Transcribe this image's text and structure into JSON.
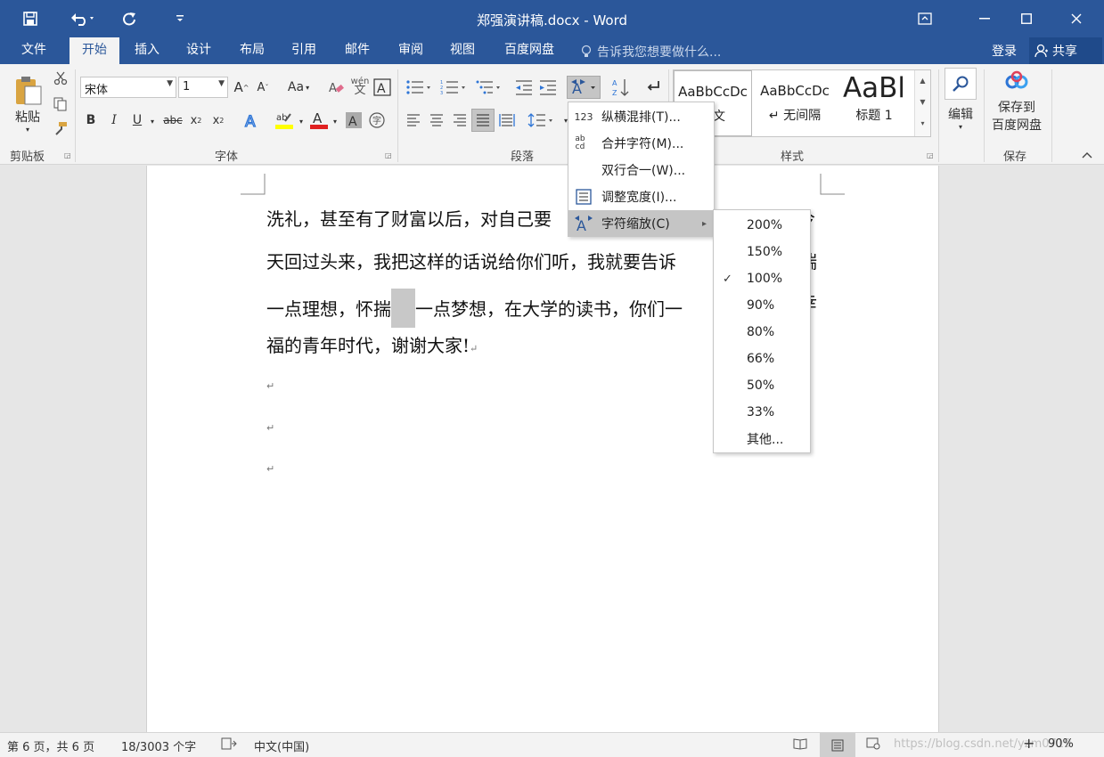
{
  "titlebar": {
    "title": "郑强演讲稿.docx - Word",
    "save_icon": "save-icon",
    "undo_icon": "undo-icon",
    "redo_icon": "redo-icon",
    "customize_icon": "customize-qat-icon"
  },
  "tabs": {
    "file": "文件",
    "home": "开始",
    "insert": "插入",
    "design": "设计",
    "layout": "布局",
    "references": "引用",
    "mailings": "邮件",
    "review": "审阅",
    "view": "视图",
    "baidu": "百度网盘"
  },
  "tellme": "告诉我您想要做什么...",
  "login": "登录",
  "share": "共享",
  "ribbon": {
    "paste": "粘贴",
    "clipboard": "剪贴板",
    "font_group": "字体",
    "paragraph_group": "段落",
    "styles_group": "样式",
    "edit_group": "编辑",
    "save_group": "保存",
    "font_name": "宋体",
    "font_size": "1",
    "edit": "编辑",
    "save_to_line1": "保存到",
    "save_to_line2": "百度网盘",
    "case_button": "Aa",
    "styles": [
      {
        "preview": "AaBbCcDc",
        "label": "正文"
      },
      {
        "preview": "AaBbCcDc",
        "label": "↵ 无间隔"
      },
      {
        "preview": "AaBl",
        "label": "标题 1"
      }
    ]
  },
  "document": {
    "lines": [
      "洗礼，甚至有了财富以后，对自己要",
      "天回过头来，我把这样的话说给你们听，我就要告诉",
      "一点梦想，在大学的读书，你们一",
      "福的青年时代，谢谢大家!"
    ],
    "line1_tail": "今",
    "line2_tail": "揣",
    "line3_head": "一点理想，怀揣",
    "line3_tail": "幸",
    "para_mark": "↵"
  },
  "dropdown": {
    "items": [
      {
        "icon": "123",
        "label": "纵横混排(T)..."
      },
      {
        "icon": "ab cd",
        "label": "合并字符(M)..."
      },
      {
        "icon": "",
        "label": "双行合一(W)..."
      },
      {
        "icon": "width-icon",
        "label": "调整宽度(I)..."
      },
      {
        "icon": "scale-icon",
        "label": "字符缩放(C)"
      }
    ],
    "submenu_arrow": "▸"
  },
  "submenu": {
    "checked": "100%",
    "check_mark": "✓",
    "items": [
      "200%",
      "150%",
      "100%",
      "90%",
      "80%",
      "66%",
      "50%",
      "33%",
      "其他..."
    ]
  },
  "statusbar": {
    "page": "第 6 页，共 6 页",
    "words": "18/3003 个字",
    "language": "中文(中国)",
    "zoom": "90%",
    "watermark": "https://blog.csdn.net/yzm0719"
  }
}
